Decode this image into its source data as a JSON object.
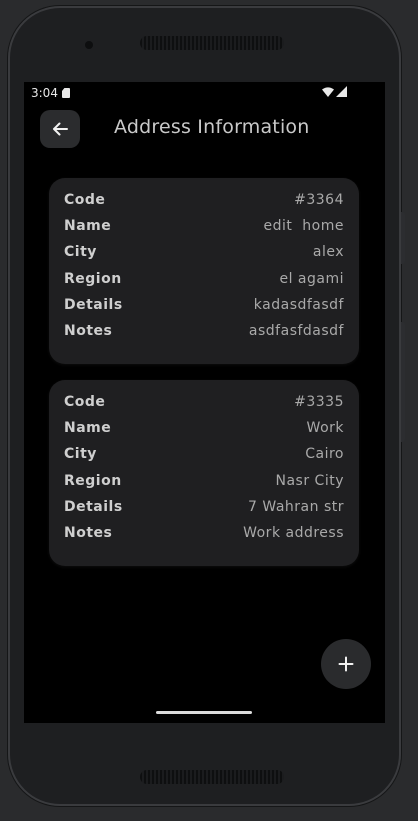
{
  "status_bar": {
    "time": "3:04",
    "icons": [
      "sd-card-icon",
      "wifi-icon",
      "cell-signal-icon"
    ]
  },
  "app_bar": {
    "back_icon": "arrow-left-icon",
    "title": "Address Information"
  },
  "addresses": [
    {
      "fields": [
        {
          "label": "Code",
          "value": "#3364"
        },
        {
          "label": "Name",
          "value": "edit  home"
        },
        {
          "label": "City",
          "value": "alex"
        },
        {
          "label": "Region",
          "value": "el agami"
        },
        {
          "label": "Details",
          "value": "kadasdfasdf"
        },
        {
          "label": "Notes",
          "value": "asdfasfdasdf"
        }
      ]
    },
    {
      "fields": [
        {
          "label": "Code",
          "value": "#3335"
        },
        {
          "label": "Name",
          "value": "Work"
        },
        {
          "label": "City",
          "value": "Cairo"
        },
        {
          "label": "Region",
          "value": "Nasr City"
        },
        {
          "label": "Details",
          "value": "7 Wahran str"
        },
        {
          "label": "Notes",
          "value": "Work address"
        }
      ]
    }
  ],
  "fab": {
    "icon": "plus-icon"
  },
  "colors": {
    "background": "#000000",
    "card": "#1f1f21",
    "label": "#cfcfcf",
    "value": "#a9a9a9"
  }
}
